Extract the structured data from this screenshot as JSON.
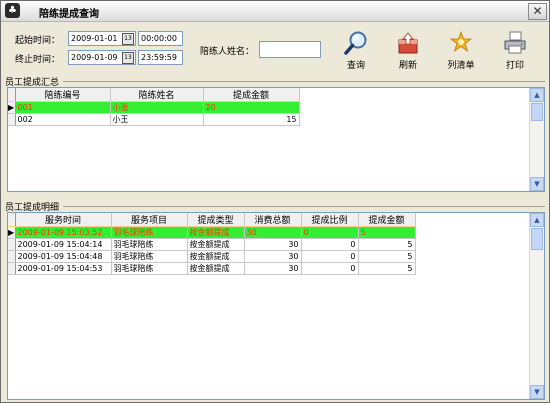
{
  "window": {
    "title": "陪练提成查询",
    "close": "✕"
  },
  "filters": {
    "start_label": "起始时间：",
    "start_date": "2009-01-01",
    "start_time": "00:00:00",
    "end_label": "终止时间：",
    "end_date": "2009-01-09",
    "end_time": "23:59:59",
    "cal_glyph": "13",
    "name_label": "陪练人姓名：",
    "name_value": ""
  },
  "toolbar": {
    "query": "查询",
    "refresh": "刷新",
    "clear": "列清单",
    "print": "打印"
  },
  "summary": {
    "group_label": "员工提成汇总",
    "columns": [
      "陪练编号",
      "陪练姓名",
      "提成金额"
    ],
    "rows": [
      [
        "001",
        "小张",
        "20"
      ],
      [
        "002",
        "小王",
        "15"
      ]
    ]
  },
  "detail": {
    "group_label": "员工提成明细",
    "columns": [
      "服务时间",
      "服务项目",
      "提成类型",
      "消费总额",
      "提成比例",
      "提成金额"
    ],
    "rows": [
      [
        "2009-01-09 15:03:52",
        "羽毛球陪练",
        "按金额提成",
        "30",
        "0",
        "5"
      ],
      [
        "2009-01-09 15:04:14",
        "羽毛球陪练",
        "按金额提成",
        "30",
        "0",
        "5"
      ],
      [
        "2009-01-09 15:04:48",
        "羽毛球陪练",
        "按金额提成",
        "30",
        "0",
        "5"
      ],
      [
        "2009-01-09 15:04:53",
        "羽毛球陪练",
        "按金额提成",
        "30",
        "0",
        "5"
      ]
    ]
  },
  "scroll": {
    "up": "▲",
    "down": "▼"
  }
}
